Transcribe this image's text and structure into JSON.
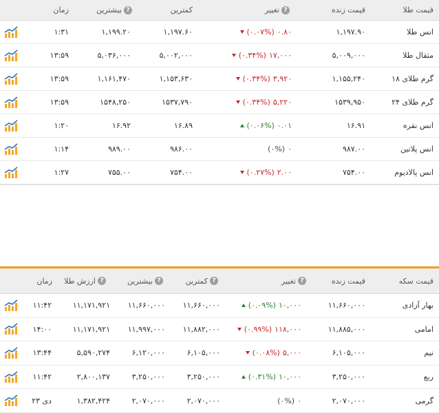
{
  "gold": {
    "headers": {
      "name": "قیمت طلا",
      "live": "قیمت زنده",
      "change": "تغییر",
      "low": "کمترین",
      "high": "بیشترین",
      "time": "زمان"
    },
    "rows": [
      {
        "name": "انس طلا",
        "live": "۱,۱۹۷.۹۰",
        "change_val": "۰.۸۰",
        "change_pct": "(۰.۰۷%)",
        "dir": "down",
        "low": "۱,۱۹۷.۶۰",
        "high": "۱,۱۹۹.۲۰",
        "time": "۱:۳۱"
      },
      {
        "name": "مثقال طلا",
        "live": "۵,۰۰۹,۰۰۰",
        "change_val": "۱۷,۰۰۰",
        "change_pct": "(۰.۳۴%)",
        "dir": "down",
        "low": "۵,۰۰۲,۰۰۰",
        "high": "۵,۰۳۶,۰۰۰",
        "time": "۱۳:۵۹"
      },
      {
        "name": "گرم طلای ۱۸",
        "live": "۱,۱۵۵,۲۴۰",
        "change_val": "۳,۹۲۰",
        "change_pct": "(۰.۳۴%)",
        "dir": "down",
        "low": "۱,۱۵۳,۶۳۰",
        "high": "۱,۱۶۱,۴۷۰",
        "time": "۱۳:۵۹"
      },
      {
        "name": "گرم طلای ۲۴",
        "live": "۱۵۳۹,۹۵۰",
        "change_val": "۵,۲۲۰",
        "change_pct": "(۰.۳۴%)",
        "dir": "down",
        "low": "۱۵۳۷,۷۹۰",
        "high": "۱۵۴۸,۲۵۰",
        "time": "۱۳:۵۹"
      },
      {
        "name": "انس نقره",
        "live": "۱۶.۹۱",
        "change_val": "۰.۰۱",
        "change_pct": "(۰.۰۶%)",
        "dir": "up",
        "low": "۱۶.۸۹",
        "high": "۱۶.۹۲",
        "time": "۱:۲۰"
      },
      {
        "name": "انس پلاتین",
        "live": "۹۸۷.۰۰",
        "change_val": "۰",
        "change_pct": "(۰%)",
        "dir": "none",
        "low": "۹۸۶.۰۰",
        "high": "۹۸۹.۰۰",
        "time": "۱:۱۴"
      },
      {
        "name": "انس پالادیوم",
        "live": "۷۵۴.۰۰",
        "change_val": "۲.۰۰",
        "change_pct": "(۰.۲۷%)",
        "dir": "down",
        "low": "۷۵۴.۰۰",
        "high": "۷۵۵.۰۰",
        "time": "۱:۲۷"
      }
    ]
  },
  "coins": {
    "headers": {
      "name": "قیمت سکه",
      "live": "قیمت زنده",
      "change": "تغییر",
      "low": "کمترین",
      "high": "بیشترین",
      "gold_value": "ارزش طلا",
      "time": "زمان"
    },
    "rows": [
      {
        "name": "بهار آزادی",
        "live": "۱۱,۶۶۰,۰۰۰",
        "change_val": "۱۰,۰۰۰",
        "change_pct": "(۰.۰۹%)",
        "dir": "up",
        "low": "۱۱,۶۶۰,۰۰۰",
        "high": "۱۱,۶۶۰,۰۰۰",
        "gold_value": "۱۱,۱۷۱,۹۲۱",
        "time": "۱۱:۴۲"
      },
      {
        "name": "امامی",
        "live": "۱۱,۸۸۵,۰۰۰",
        "change_val": "۱۱۸,۰۰۰",
        "change_pct": "(۰.۹۹%)",
        "dir": "down",
        "low": "۱۱,۸۸۲,۰۰۰",
        "high": "۱۱,۹۹۷,۰۰۰",
        "gold_value": "۱۱,۱۷۱,۹۲۱",
        "time": "۱۴:۰۰"
      },
      {
        "name": "نیم",
        "live": "۶,۱۰۵,۰۰۰",
        "change_val": "۵,۰۰۰",
        "change_pct": "(۰.۰۸%)",
        "dir": "down",
        "low": "۶,۱۰۵,۰۰۰",
        "high": "۶,۱۲۰,۰۰۰",
        "gold_value": "۵,۵۹۰,۲۷۴",
        "time": "۱۳:۴۴"
      },
      {
        "name": "ربع",
        "live": "۳,۲۵۰,۰۰۰",
        "change_val": "۱۰,۰۰۰",
        "change_pct": "(۰.۳۱%)",
        "dir": "up",
        "low": "۳,۲۵۰,۰۰۰",
        "high": "۳,۲۵۰,۰۰۰",
        "gold_value": "۲,۸۰۰,۱۳۷",
        "time": "۱۱:۴۲"
      },
      {
        "name": "گرمی",
        "live": "۲,۰۷۰,۰۰۰",
        "change_val": "۰",
        "change_pct": "(۰%)",
        "dir": "none",
        "low": "۲,۰۷۰,۰۰۰",
        "high": "۲,۰۷۰,۰۰۰",
        "gold_value": "۱,۳۸۲,۴۲۴",
        "time": "۲۳ دی"
      }
    ]
  },
  "icons": {
    "help": "question-icon",
    "chart": "chart-icon"
  },
  "colors": {
    "accent": "#f79a1e",
    "down": "#c62828",
    "up": "#2e7d32",
    "header_bg": "#eeeeee"
  }
}
